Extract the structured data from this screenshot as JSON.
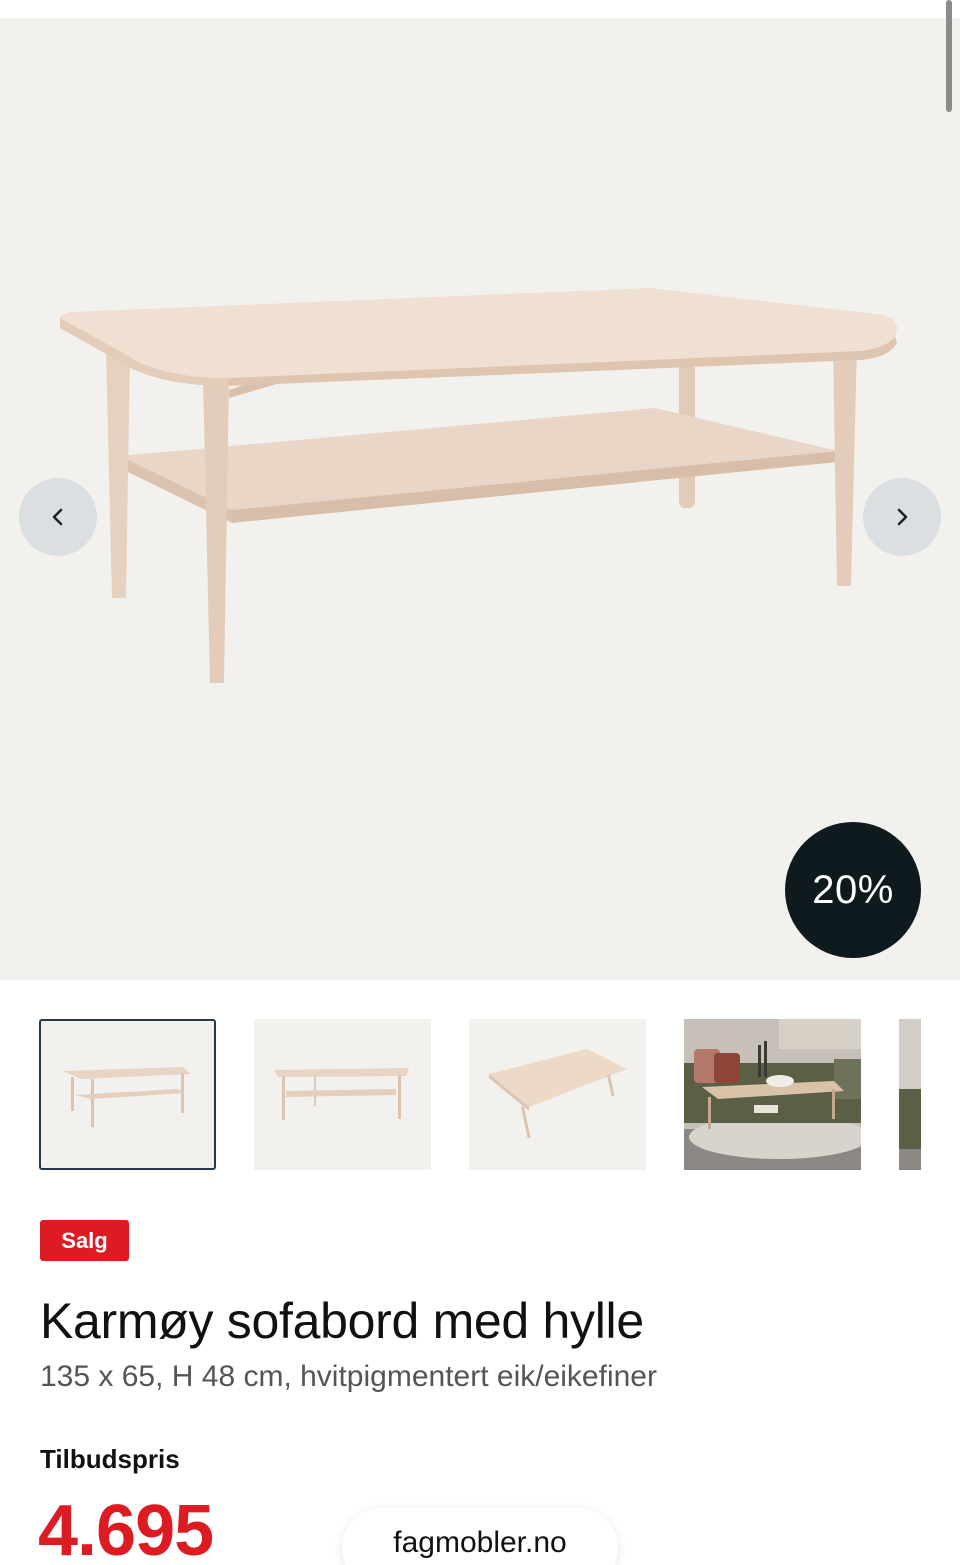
{
  "gallery": {
    "discount_badge": "20%",
    "prev_icon": "chevron-left-icon",
    "next_icon": "chevron-right-icon",
    "thumbnail_count_visible": 5,
    "active_thumbnail": 1
  },
  "product": {
    "badge": "Salg",
    "title": "Karmøy sofabord med hylle",
    "subtitle": "135 x 65, H 48 cm, hvitpigmentert eik/eikefiner",
    "price_label": "Tilbudspris",
    "price": "4.695"
  },
  "browser": {
    "url": "fagmobler.no"
  },
  "colors": {
    "sale_red": "#dd1b22",
    "badge_dark": "#0f1a1f",
    "active_border": "#26394a",
    "image_bg": "#f3f1ee"
  }
}
